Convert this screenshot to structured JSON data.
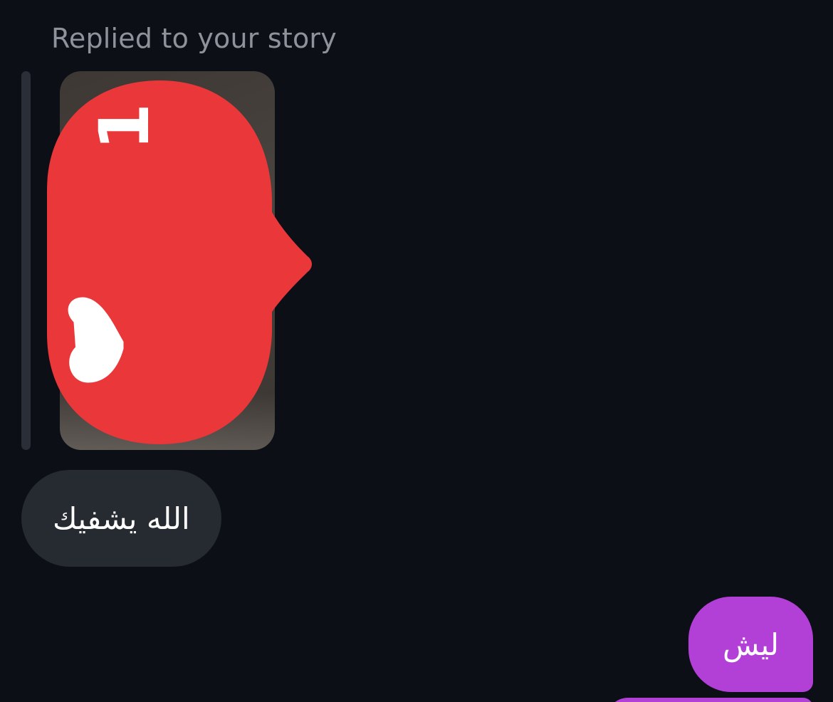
{
  "thread": {
    "reply_context": "Replied to your story",
    "story": {
      "sticker_icon": "heart-icon",
      "like_count": "1",
      "sticker_color": "#e9373a"
    },
    "messages": [
      {
        "from": "them",
        "text": "الله يشفيك"
      },
      {
        "from": "me",
        "text": "ليش"
      }
    ]
  },
  "colors": {
    "background": "#0c0f16",
    "received_bubble": "#262a31",
    "sent_bubble": "#b23fd6",
    "label_text": "#8e939b"
  }
}
